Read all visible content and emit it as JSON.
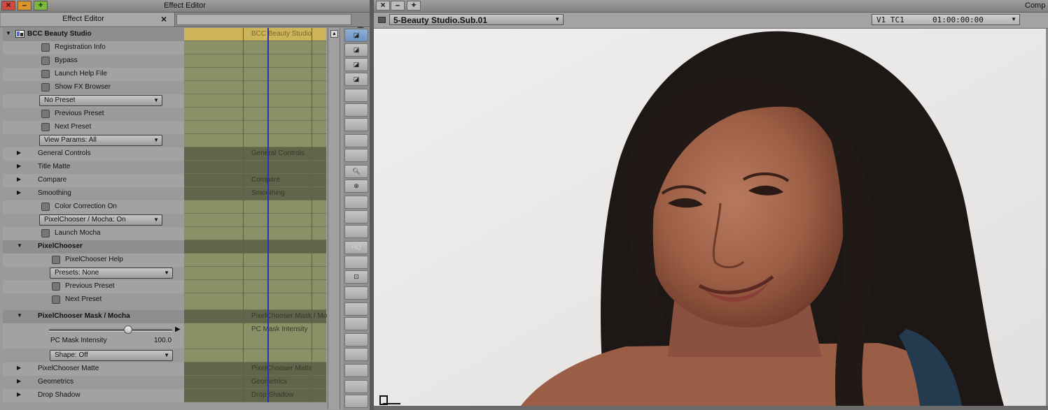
{
  "effect_editor": {
    "window_title": "Effect Editor",
    "tab_label": "Effect Editor",
    "tab_close": "×",
    "window_buttons": {
      "close": "×",
      "minimize": "–",
      "maximize": "+"
    },
    "menu_icon": "chevron-down-icon",
    "effect_name": "BCC Beauty Studio",
    "params": {
      "registration": "Registration Info",
      "bypass": "Bypass",
      "launch_help": "Launch Help File",
      "show_fx": "Show FX Browser",
      "preset_dropdown": "No Preset",
      "prev_preset": "Previous Preset",
      "next_preset": "Next Preset",
      "view_params": "View Params: All",
      "general_controls": "General Controls",
      "title_matte": "Title Matte",
      "compare": "Compare",
      "smoothing": "Smoothing",
      "color_correction": "Color Correction On",
      "pixelchooser_mocha": "PixelChooser / Mocha: On",
      "launch_mocha": "Launch Mocha",
      "pixelchooser": "PixelChooser",
      "pc_help": "PixelChooser Help",
      "pc_presets": "Presets: None",
      "pc_prev_preset": "Previous Preset",
      "pc_next_preset": "Next Preset",
      "pc_mask_mocha": "PixelChooser Mask / Mocha",
      "pc_mask_intensity_label": "PC Mask Intensity",
      "pc_mask_intensity_value": "100.0",
      "pc_mask_intensity_level": 1.0,
      "pc_shape": "Shape: Off",
      "pc_matte": "PixelChooser Matte",
      "geometrics": "Geometrics",
      "drop_shadow": "Drop  Shadow"
    },
    "timeline": {
      "top": "BCC Beauty Studio",
      "general_controls": "General Controls",
      "compare": "Compare",
      "smoothing": "Smoothing",
      "pc_mask_mocha": "PixelChooser Mask / Mo",
      "pc_mask_intensity": "PC Mask Intensity",
      "pc_matte": "PixelChooser Matte",
      "geometrics": "Geometrics",
      "drop_shadow": "Drop  Shadow"
    },
    "tools": {
      "hq": "HQ"
    }
  },
  "composer": {
    "window_title": "Comp",
    "window_buttons": {
      "close": "×",
      "minimize": "–",
      "maximize": "+"
    },
    "clip_name": "5-Beauty Studio.Sub.01",
    "track": "V1  TC1",
    "timecode": "01:00:00:00"
  },
  "colors": {
    "timeline_green": "#8a9167",
    "timeline_dark": "#616549",
    "timeline_top": "#cdb35a",
    "position_indicator": "#2b2fb3",
    "selected_tool": "#7fa2cc"
  }
}
